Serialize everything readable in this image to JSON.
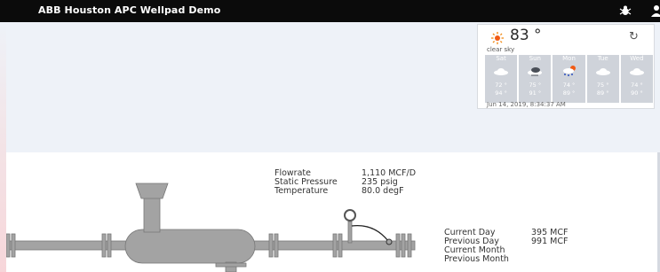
{
  "header": {
    "title": "ABB Houston APC Wellpad Demo"
  },
  "weather": {
    "temperature": "83 °",
    "condition": "clear sky",
    "timestamp": "Jun 14, 2019, 8:34:37 AM",
    "days": [
      {
        "name": "Sat",
        "icon": "cloud-icon",
        "hi": "72 °",
        "lo": "94 °"
      },
      {
        "name": "Sun",
        "icon": "storm-cloud-icon",
        "hi": "75 °",
        "lo": "91 °"
      },
      {
        "name": "Mon",
        "icon": "rain-sun-icon",
        "hi": "74 °",
        "lo": "89 °"
      },
      {
        "name": "Tue",
        "icon": "cloud-icon",
        "hi": "75 °",
        "lo": "89 °"
      },
      {
        "name": "Wed",
        "icon": "cloud-icon",
        "hi": "74 °",
        "lo": "90 °"
      }
    ]
  },
  "process": {
    "rows": [
      {
        "label": "Flowrate",
        "value": "1,110 MCF/D"
      },
      {
        "label": "Static Pressure",
        "value": "235 psig"
      },
      {
        "label": "Temperature",
        "value": "80.0 degF"
      }
    ]
  },
  "production": {
    "rows": [
      {
        "label": "Current Day",
        "value": "395 MCF"
      },
      {
        "label": "Previous Day",
        "value": "991 MCF"
      },
      {
        "label": "Current Month",
        "value": ""
      },
      {
        "label": "Previous Month",
        "value": ""
      }
    ]
  },
  "colors": {
    "equipment": "#a3a3a3",
    "topbar": "#0b0b0b"
  }
}
